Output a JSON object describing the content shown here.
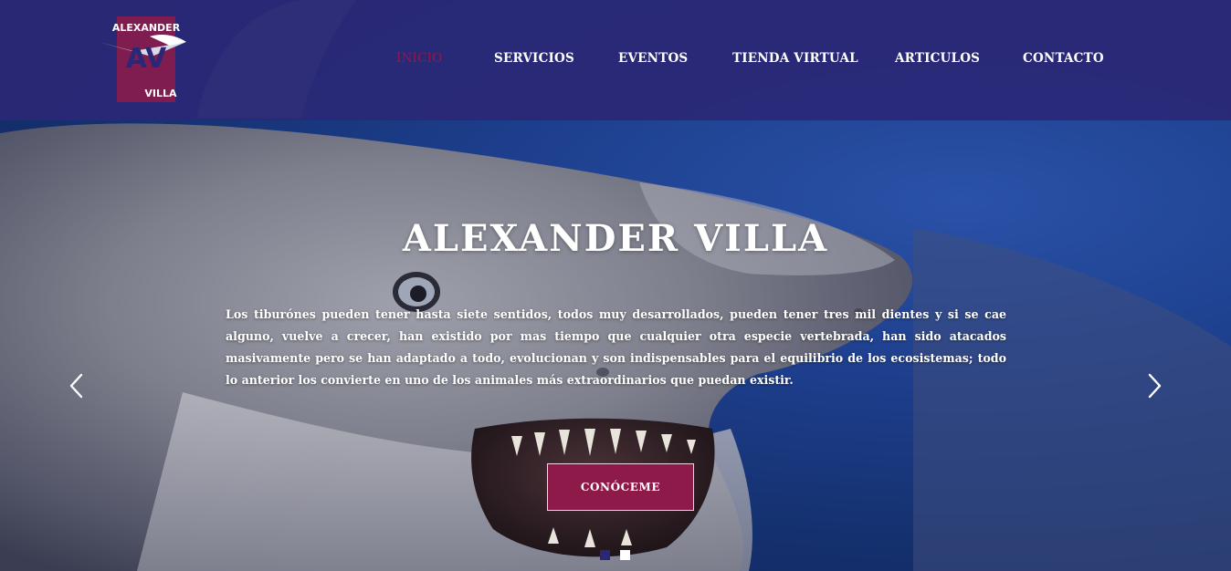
{
  "brand": {
    "logo_top": "ALEXANDER",
    "logo_mid": "AV",
    "logo_bottom": "VILLA",
    "accent_color": "#8e1a4a",
    "header_color": "#2a2876"
  },
  "nav": {
    "items": [
      {
        "label": "INICIO",
        "active": true
      },
      {
        "label": "SERVICIOS",
        "active": false
      },
      {
        "label": "EVENTOS",
        "active": false
      },
      {
        "label": "TIENDA VIRTUAL",
        "active": false
      },
      {
        "label": "ARTICULOS",
        "active": false
      },
      {
        "label": "CONTACTO",
        "active": false
      }
    ]
  },
  "hero": {
    "title": "ALEXANDER VILLA",
    "text": "Los tiburónes pueden tener hasta siete sentidos, todos muy desarrollados, pueden tener tres mil dientes y si se cae alguno, vuelve a crecer, han existido por mas tiempo que cualquier otra especie vertebrada, han sido atacados masivamente pero se han adaptado a todo, evolucionan y son indispensables para el equilibrio de los ecosistemas; todo lo anterior los convierte en uno de los animales más extraordinarios que puedan existir.",
    "cta_label": "CONÓCEME",
    "background_icon": "shark-photo"
  },
  "carousel": {
    "prev_icon": "chevron-left-icon",
    "next_icon": "chevron-right-icon",
    "slide_count": 2,
    "active_slide": 1
  }
}
